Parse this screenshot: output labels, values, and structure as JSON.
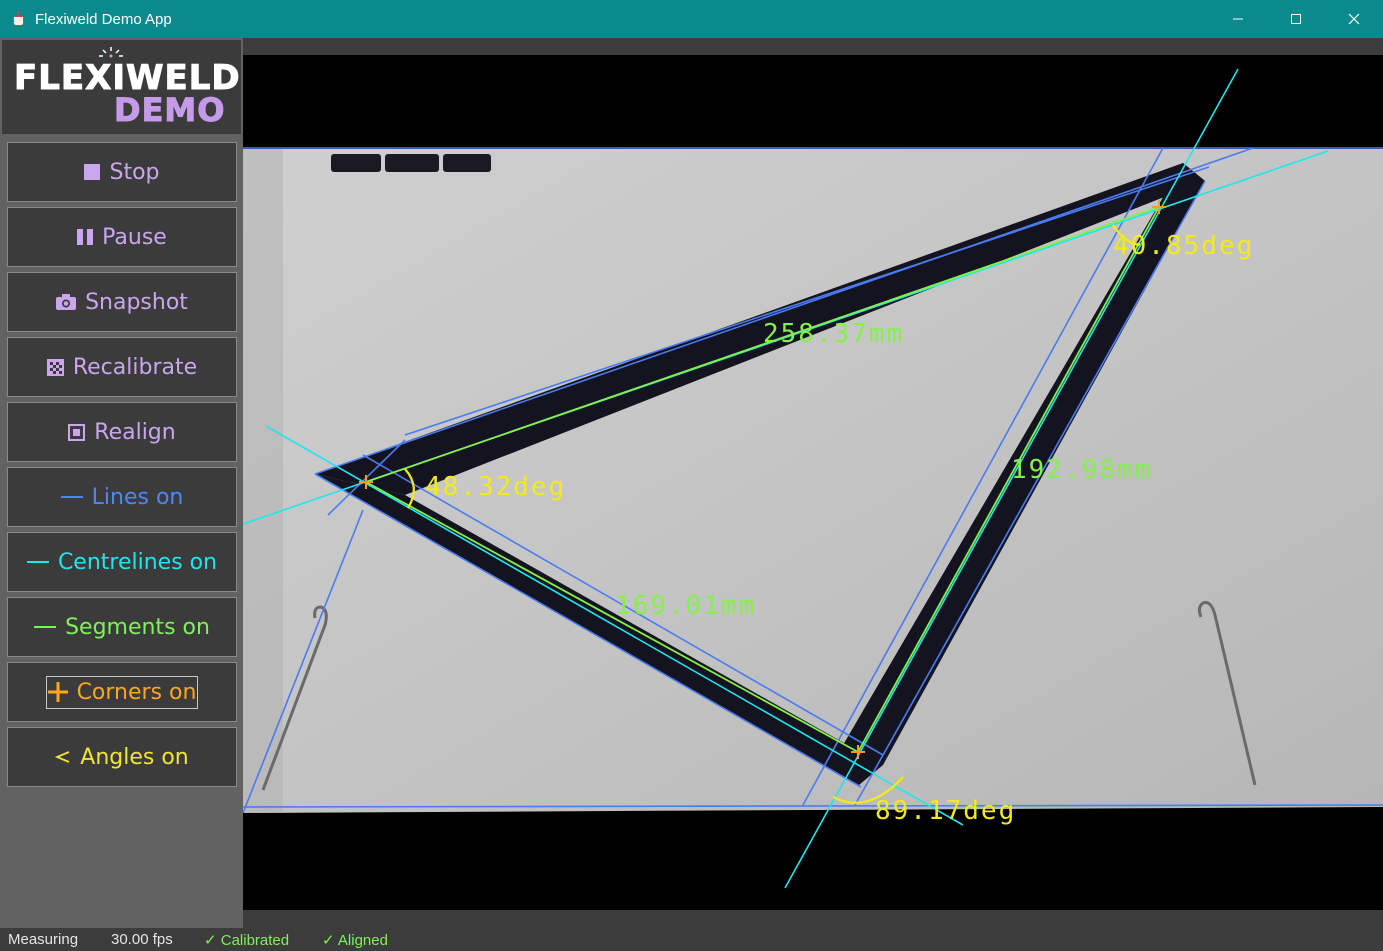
{
  "window": {
    "title": "Flexiweld Demo App",
    "app_icon": "java-cup-icon"
  },
  "logo": {
    "line1": "FLEXIWELD",
    "line2": "DEMO",
    "colors": {
      "line1": "#ffffff",
      "line2": "#c59ae8"
    }
  },
  "sidebar": {
    "buttons": [
      {
        "label": "Stop",
        "icon": "stop-square-icon",
        "color": "#c9a6ee"
      },
      {
        "label": "Pause",
        "icon": "pause-icon",
        "color": "#c9a6ee"
      },
      {
        "label": "Snapshot",
        "icon": "camera-icon",
        "color": "#c9a6ee"
      },
      {
        "label": "Recalibrate",
        "icon": "checkerboard-icon",
        "color": "#c9a6ee"
      },
      {
        "label": "Realign",
        "icon": "realign-square-icon",
        "color": "#c9a6ee"
      },
      {
        "label": "Lines on",
        "icon": "dash-line-icon",
        "color": "#4f86f7"
      },
      {
        "label": "Centrelines on",
        "icon": "dash-line-icon",
        "color": "#1ee6ee"
      },
      {
        "label": "Segments on",
        "icon": "dash-line-icon",
        "color": "#7df25a"
      },
      {
        "label": "Corners on",
        "icon": "plus-icon",
        "color": "#ffa51e"
      },
      {
        "label": "Angles on",
        "icon": "angle-icon",
        "color": "#f0e62e"
      }
    ]
  },
  "measurements": {
    "segments": [
      {
        "label": "258.37mm"
      },
      {
        "label": "192.98mm"
      },
      {
        "label": "169.01mm"
      }
    ],
    "angles": [
      {
        "label": "40.85deg"
      },
      {
        "label": "48.32deg"
      },
      {
        "label": "89.17deg"
      }
    ],
    "colors": {
      "lines": "#4a7cf0",
      "centrelines": "#1ee6ee",
      "segments": "#86f04a",
      "corners": "#ff9c1e",
      "angles": "#f2ea1a",
      "segment_text": "#86f04a",
      "angle_text": "#f2ea1a"
    }
  },
  "status": {
    "mode": "Measuring",
    "fps": "30.00 fps",
    "calibrated": "✓ Calibrated",
    "aligned": "✓ Aligned",
    "ok_color": "#7df25a"
  }
}
